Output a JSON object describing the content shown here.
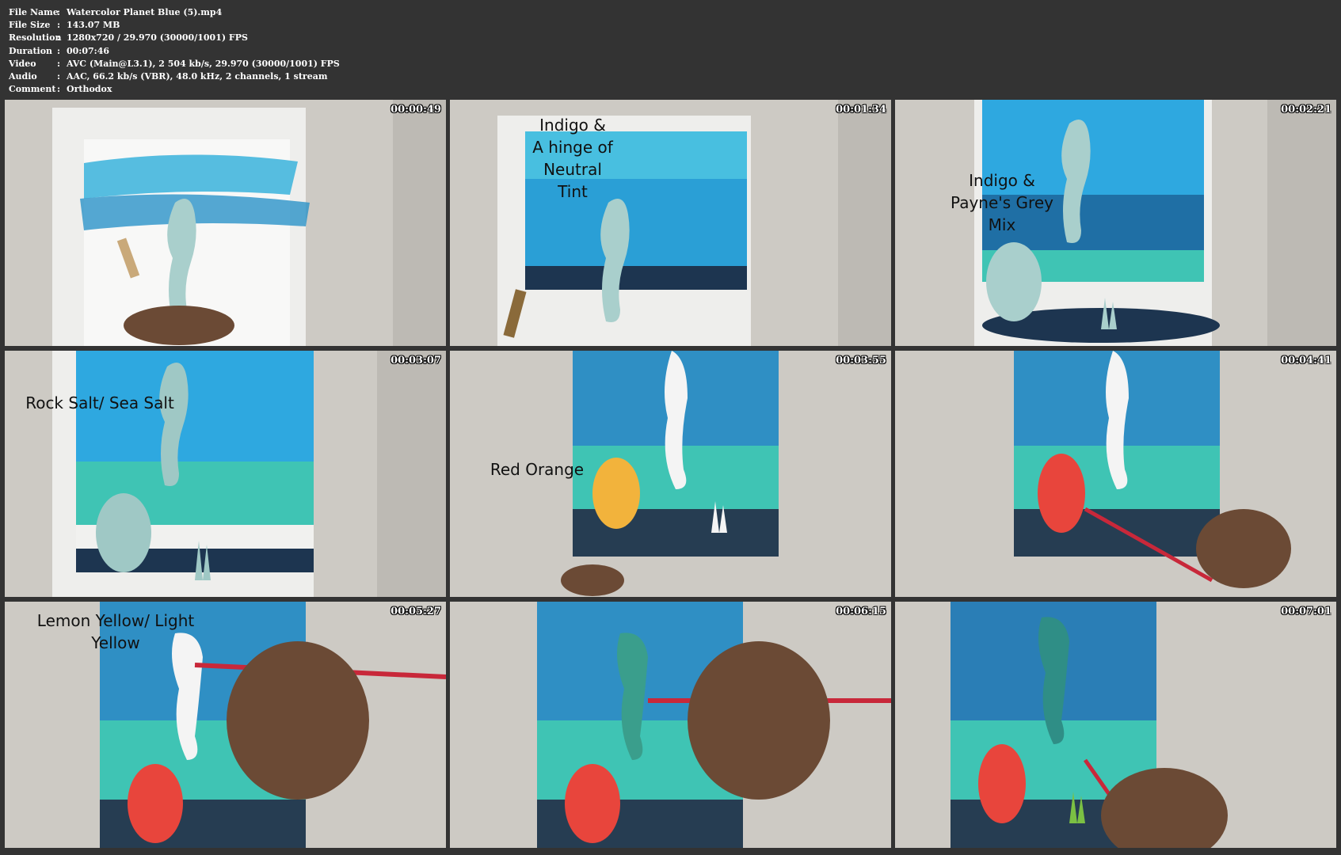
{
  "media_info": {
    "rows": [
      {
        "key": "File Name",
        "value": "Watercolor Planet Blue (5).mp4"
      },
      {
        "key": "File Size",
        "value": "143.07 MB"
      },
      {
        "key": "Resolution",
        "value": "1280x720 / 29.970 (30000/1001) FPS"
      },
      {
        "key": "Duration",
        "value": "00:07:46"
      },
      {
        "key": "Video",
        "value": "AVC (Main@L3.1), 2 504 kb/s, 29.970 (30000/1001) FPS"
      },
      {
        "key": "Audio",
        "value": "AAC, 66.2 kb/s (VBR), 48.0 kHz, 2 channels, 1 stream"
      },
      {
        "key": "Comment",
        "value": "Orthodox"
      }
    ],
    "separator": ":"
  },
  "thumbnails": [
    {
      "timestamp": "00:00:49",
      "caption": ""
    },
    {
      "timestamp": "00:01:34",
      "caption": "Indigo &\nA hinge of\nNeutral Tint"
    },
    {
      "timestamp": "00:02:21",
      "caption": "Indigo &\nPayne's Grey Mix"
    },
    {
      "timestamp": "00:03:07",
      "caption": "Rock Salt/ Sea Salt"
    },
    {
      "timestamp": "00:03:55",
      "caption": "Red Orange"
    },
    {
      "timestamp": "00:04:41",
      "caption": ""
    },
    {
      "timestamp": "00:05:27",
      "caption": "Lemon Yellow/ Light Yellow"
    },
    {
      "timestamp": "00:06:15",
      "caption": ""
    },
    {
      "timestamp": "00:07:01",
      "caption": ""
    }
  ],
  "colors": {
    "background": "#333333",
    "table": "#c9c6c0",
    "paper": "#f4f3f1",
    "sky_blue": "#3ab3dc",
    "deep_blue": "#1f6fa5",
    "teal": "#3fc4b4",
    "navy": "#1d3550",
    "coral_red": "#e8453c",
    "seahorse": "#a9cfcc"
  }
}
